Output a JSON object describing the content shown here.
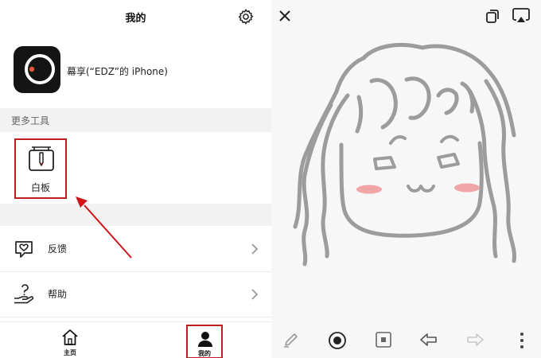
{
  "header": {
    "title": "我的"
  },
  "device": {
    "name": "幕享(“EDZ”的 iPhone)"
  },
  "tools_section": {
    "label": "更多工具",
    "items": [
      {
        "label": "白板",
        "icon": "whiteboard-icon"
      }
    ]
  },
  "menu": [
    {
      "label": "反馈",
      "icon": "feedback-icon"
    },
    {
      "label": "帮助",
      "icon": "help-icon"
    }
  ],
  "tabbar": {
    "items": [
      {
        "label": "主页",
        "icon": "home-icon"
      },
      {
        "label": "我的",
        "icon": "profile-icon",
        "active": true
      }
    ]
  },
  "whiteboard": {
    "top_buttons": [
      "close-icon",
      "copy-icon",
      "cast-icon"
    ],
    "toolbar": [
      "pen-icon",
      "record-icon",
      "stop-icon",
      "undo-icon",
      "redo-icon",
      "more-icon"
    ]
  },
  "colors": {
    "highlight": "#c01d1d",
    "stroke": "#9c9c9c",
    "blush": "#f0a6a6",
    "section_bg": "#f2f2f2"
  }
}
